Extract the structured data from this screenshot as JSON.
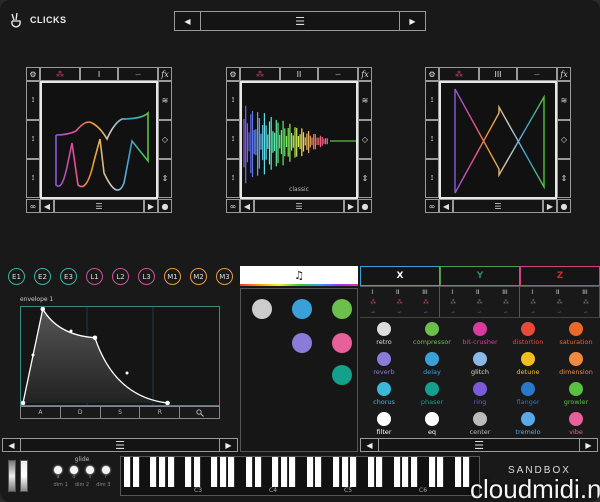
{
  "app": {
    "name": "CLICKS",
    "brand": "SANDBOX",
    "watermark": "cloudmidi.net"
  },
  "top_nav": {
    "prev": "◀",
    "menu": "☰",
    "next": "▶"
  },
  "oscillators": [
    {
      "id": "osc-1",
      "label": "I",
      "caption": "",
      "mode_tabs": [
        "noise",
        "I",
        "wave"
      ],
      "active_wave": "wave"
    },
    {
      "id": "osc-2",
      "label": "II",
      "caption": "classic",
      "mode_tabs": [
        "noise",
        "II",
        "wave"
      ],
      "active_wave": "noise"
    },
    {
      "id": "osc-3",
      "label": "III",
      "caption": "",
      "mode_tabs": [
        "noise",
        "III",
        "wave"
      ],
      "active_wave": "wave"
    }
  ],
  "osc_nav": {
    "prev": "◀",
    "menu": "☰",
    "next": "▶",
    "fx": "fx"
  },
  "mod_sources": [
    {
      "label": "E1",
      "color": "#2fb7a4"
    },
    {
      "label": "E2",
      "color": "#2fb7a4"
    },
    {
      "label": "E3",
      "color": "#2fb7a4"
    },
    {
      "label": "L1",
      "color": "#d0509a"
    },
    {
      "label": "L2",
      "color": "#d0509a"
    },
    {
      "label": "L3",
      "color": "#d0509a"
    },
    {
      "label": "M1",
      "color": "#e89a3a"
    },
    {
      "label": "M2",
      "color": "#e89a3a"
    },
    {
      "label": "M3",
      "color": "#e89a3a"
    }
  ],
  "envelope": {
    "title": "envelope 1",
    "stages": [
      "A",
      "D",
      "S",
      "R"
    ],
    "zoom_icon": "🔍",
    "attack": 0.11,
    "decay": 0.31,
    "sustain": 0.7,
    "release": 0.74
  },
  "left_nav": {
    "prev": "◀",
    "menu": "☰",
    "next": "▶"
  },
  "fx_header": {
    "icon": "♫"
  },
  "fx_chain": [
    {
      "name": "center",
      "color": "#cccccc"
    },
    {
      "name": "delay",
      "color": "#3aa0d8"
    },
    {
      "name": "compressor",
      "color": "#6bbf4a"
    },
    {
      "name": "reverb",
      "color": "#8b7bd8"
    },
    {
      "name": "vibe",
      "color": "#e8609a"
    },
    {
      "name": "phaser",
      "color": "#14a08a"
    }
  ],
  "xyz_tabs": [
    {
      "label": "X",
      "color": "#ffffff",
      "border": "#3aa0d8"
    },
    {
      "label": "Y",
      "color": "#2e8a5a",
      "border": "#4a9a4a"
    },
    {
      "label": "Z",
      "color": "#c03030",
      "border": "#d04080"
    }
  ],
  "xyz_rows": {
    "osc": [
      "I",
      "II",
      "III"
    ],
    "noise_glyph": "⁂",
    "wave_glyph": "∽"
  },
  "fx_list": [
    {
      "name": "retro",
      "color": "#dddddd",
      "label_color": "#dddddd"
    },
    {
      "name": "compressor",
      "color": "#6bbf4a",
      "label_color": "#6bbf4a"
    },
    {
      "name": "bit-crusher",
      "color": "#d83aa0",
      "label_color": "#d83aa0"
    },
    {
      "name": "distortion",
      "color": "#e84a3a",
      "label_color": "#e84a3a"
    },
    {
      "name": "saturation",
      "color": "#e86a2a",
      "label_color": "#e86a2a"
    },
    {
      "name": "reverb",
      "color": "#8b7bd8",
      "label_color": "#8b7bd8"
    },
    {
      "name": "delay",
      "color": "#3aa0d8",
      "label_color": "#3aa0d8"
    },
    {
      "name": "glitch",
      "color": "#8ab8e8",
      "label_color": "#dddddd"
    },
    {
      "name": "detune",
      "color": "#f0c020",
      "label_color": "#f0c020"
    },
    {
      "name": "dimension",
      "color": "#f08a40",
      "label_color": "#f08a40"
    },
    {
      "name": "chorus",
      "color": "#3ab8d8",
      "label_color": "#3ab8d8"
    },
    {
      "name": "phaser",
      "color": "#14a08a",
      "label_color": "#14a08a"
    },
    {
      "name": "ring",
      "color": "#7a5ad8",
      "label_color": "#7a5ad8"
    },
    {
      "name": "flanger",
      "color": "#2a78c8",
      "label_color": "#2a78c8"
    },
    {
      "name": "growler",
      "color": "#5ac040",
      "label_color": "#5ac040"
    },
    {
      "name": "filter",
      "color": "#ffffff",
      "label_color": "#ffffff"
    },
    {
      "name": "eq",
      "color": "#ffffff",
      "label_color": "#ffffff"
    },
    {
      "name": "center",
      "color": "#bbbbbb",
      "label_color": "#bbbbbb"
    },
    {
      "name": "tremelo",
      "color": "#5aa8e8",
      "label_color": "#5aa8e8"
    },
    {
      "name": "vibe",
      "color": "#e8609a",
      "label_color": "#e8609a"
    }
  ],
  "right_nav": {
    "prev": "◀",
    "menu": "☰",
    "next": "▶"
  },
  "glide": {
    "title": "glide",
    "knobs": [
      "a",
      "d",
      "s",
      "r"
    ],
    "dim_labels": [
      "dim 1",
      "dim 2",
      "dim 3"
    ]
  },
  "keyboard": {
    "octave_labels": [
      "C3",
      "C4",
      "C5",
      "C6"
    ]
  }
}
